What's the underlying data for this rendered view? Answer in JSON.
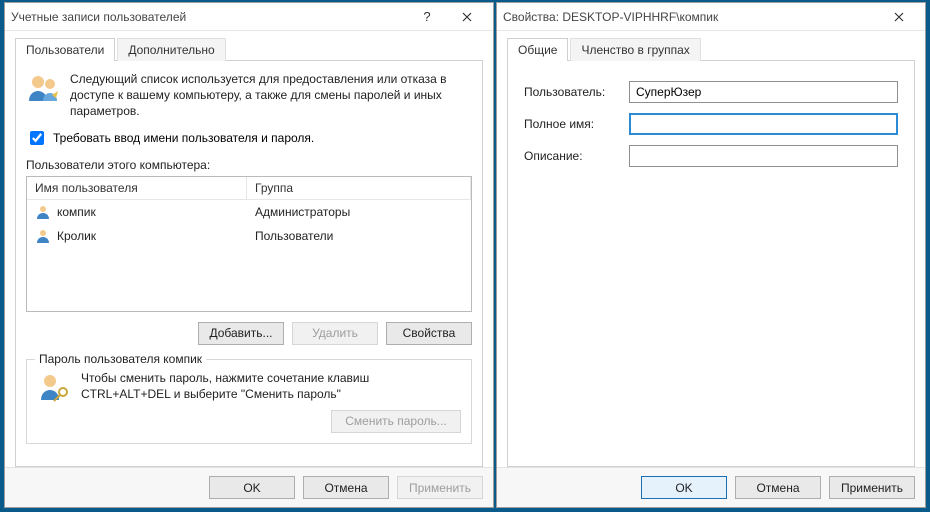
{
  "left": {
    "title": "Учетные записи пользователей",
    "tabs": {
      "users": "Пользователи",
      "advanced": "Дополнительно"
    },
    "intro": "Следующий список используется для предоставления или отказа в доступе к вашему компьютеру, а также для смены паролей и иных параметров.",
    "require_login": "Требовать ввод имени пользователя и пароля.",
    "list_label": "Пользователи этого компьютера:",
    "columns": {
      "name": "Имя пользователя",
      "group": "Группа"
    },
    "rows": [
      {
        "name": "компик",
        "group": "Администраторы"
      },
      {
        "name": "Кролик",
        "group": "Пользователи"
      }
    ],
    "buttons": {
      "add": "Добавить...",
      "delete": "Удалить",
      "props": "Свойства"
    },
    "password_box": {
      "title": "Пароль пользователя компик",
      "text": "Чтобы сменить пароль, нажмите сочетание клавиш CTRL+ALT+DEL и выберите \"Сменить пароль\"",
      "change": "Сменить пароль..."
    },
    "dlg": {
      "ok": "OK",
      "cancel": "Отмена",
      "apply": "Применить"
    }
  },
  "right": {
    "title": "Свойства: DESKTOP-VIPHHRF\\компик",
    "tabs": {
      "general": "Общие",
      "membership": "Членство в группах"
    },
    "fields": {
      "user_label": "Пользователь:",
      "user_value": "СуперЮзер",
      "fullname_label": "Полное имя:",
      "fullname_value": "",
      "desc_label": "Описание:",
      "desc_value": ""
    },
    "dlg": {
      "ok": "OK",
      "cancel": "Отмена",
      "apply": "Применить"
    }
  }
}
